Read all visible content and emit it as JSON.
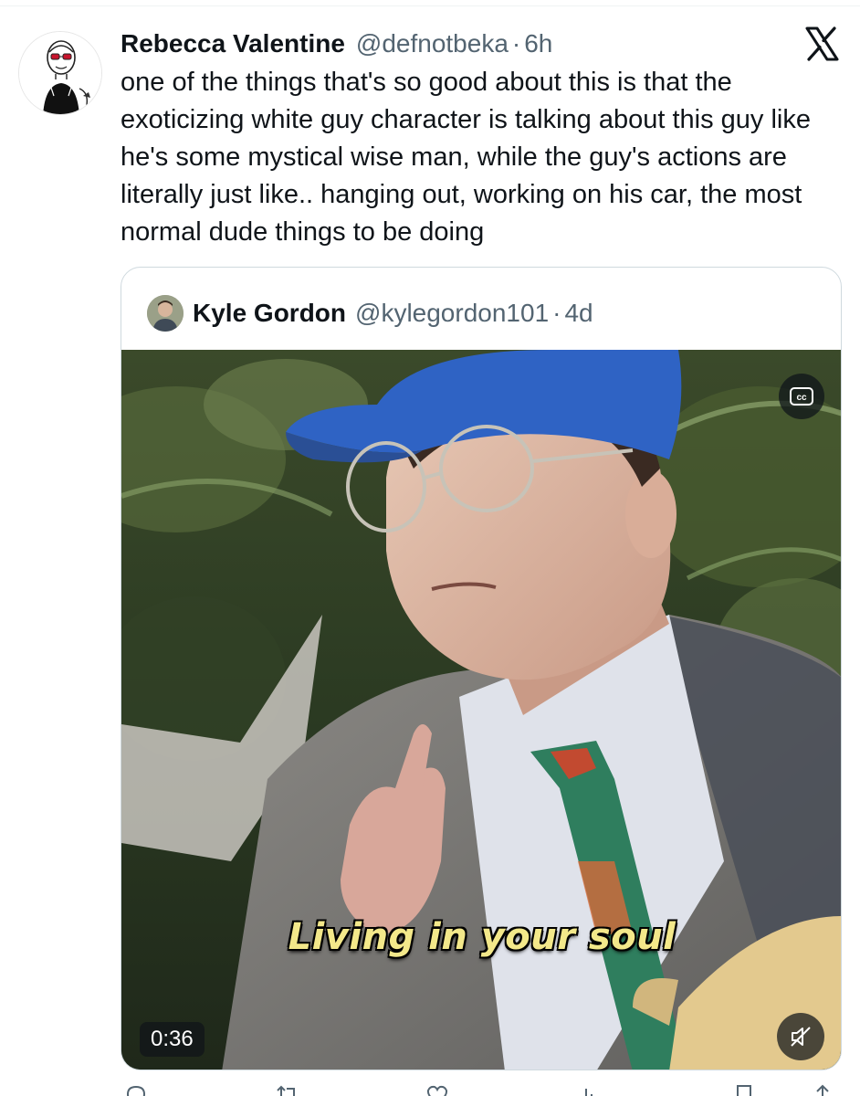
{
  "tweet": {
    "author_name": "Rebecca Valentine",
    "author_handle": "@defnotbeka",
    "separator": "·",
    "timestamp": "6h",
    "text": "one of the things that's so good about this is that the exoticizing white guy character is talking about this guy like he's some mystical wise man, while the guy's actions are literally just like.. hanging out, working on his car, the most normal dude things to be doing",
    "logo_icon": "x-logo-icon"
  },
  "quote": {
    "author_name": "Kyle Gordon",
    "author_handle": "@kylegordon101",
    "separator": "·",
    "timestamp": "4d",
    "video": {
      "subtitle": "Living in your soul",
      "duration": "0:36",
      "captions_icon": "closed-captions-icon",
      "mute_icon": "muted-speaker-icon"
    }
  },
  "actions": {
    "reply_icon": "reply-icon",
    "repost_icon": "repost-icon",
    "like_icon": "heart-icon",
    "views_icon": "views-icon",
    "bookmark_icon": "bookmark-icon",
    "share_icon": "share-icon"
  },
  "colors": {
    "text_primary": "#0f1419",
    "text_secondary": "#536471",
    "border": "#cfd9de",
    "subtitle": "#f3e88a"
  }
}
